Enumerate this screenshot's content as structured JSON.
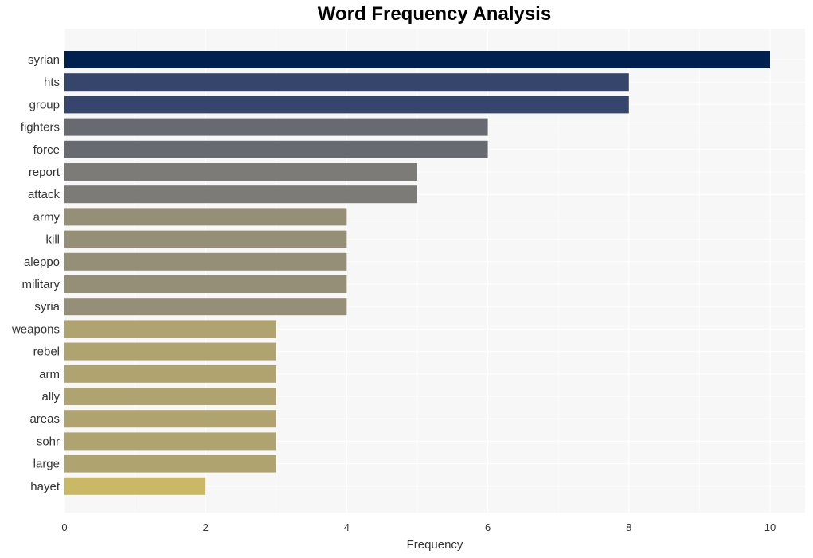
{
  "chart_data": {
    "type": "bar",
    "orientation": "horizontal",
    "title": "Word Frequency Analysis",
    "xlabel": "Frequency",
    "ylabel": "",
    "xlim": [
      0,
      10.5
    ],
    "xticks": [
      0,
      2,
      4,
      6,
      8,
      10
    ],
    "grid": true,
    "legend": "none",
    "categories": [
      "syrian",
      "hts",
      "group",
      "fighters",
      "force",
      "report",
      "attack",
      "army",
      "kill",
      "aleppo",
      "military",
      "syria",
      "weapons",
      "rebel",
      "arm",
      "ally",
      "areas",
      "sohr",
      "large",
      "hayet"
    ],
    "values": [
      10,
      8,
      8,
      6,
      6,
      5,
      5,
      4,
      4,
      4,
      4,
      4,
      3,
      3,
      3,
      3,
      3,
      3,
      3,
      2
    ],
    "colors": {
      "10": "#00204e",
      "8": "#35456b",
      "6": "#676a70",
      "5": "#7c7b78",
      "4": "#958f77",
      "3": "#afa470",
      "2": "#c9b965"
    },
    "background": "#f7f7f7"
  }
}
